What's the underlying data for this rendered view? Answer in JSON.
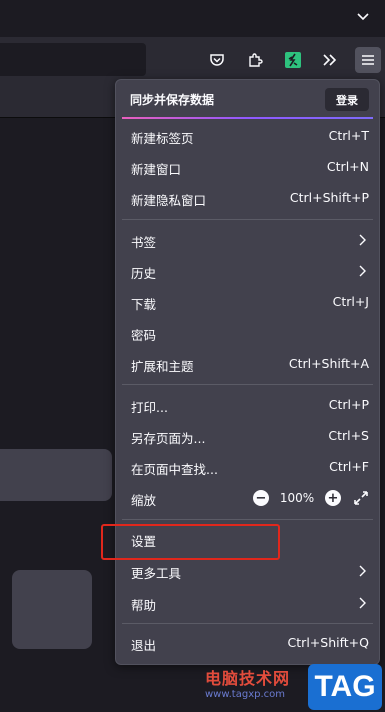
{
  "toolbar": {
    "icons": [
      "pocket-icon",
      "extensions-icon",
      "green-extension-icon",
      "overflow-icon",
      "menu-icon"
    ]
  },
  "panel": {
    "sync_label": "同步并保存数据",
    "login_label": "登录",
    "items": {
      "new_tab": {
        "label": "新建标签页",
        "shortcut": "Ctrl+T"
      },
      "new_window": {
        "label": "新建窗口",
        "shortcut": "Ctrl+N"
      },
      "new_private": {
        "label": "新建隐私窗口",
        "shortcut": "Ctrl+Shift+P"
      },
      "bookmarks": {
        "label": "书签"
      },
      "history": {
        "label": "历史"
      },
      "downloads": {
        "label": "下载",
        "shortcut": "Ctrl+J"
      },
      "passwords": {
        "label": "密码"
      },
      "addons": {
        "label": "扩展和主题",
        "shortcut": "Ctrl+Shift+A"
      },
      "print": {
        "label": "打印...",
        "shortcut": "Ctrl+P"
      },
      "save_as": {
        "label": "另存页面为...",
        "shortcut": "Ctrl+S"
      },
      "find": {
        "label": "在页面中查找...",
        "shortcut": "Ctrl+F"
      },
      "zoom": {
        "label": "缩放",
        "value": "100%",
        "minus": "−",
        "plus": "+"
      },
      "settings": {
        "label": "设置"
      },
      "more_tools": {
        "label": "更多工具"
      },
      "help": {
        "label": "帮助"
      },
      "quit": {
        "label": "退出",
        "shortcut": "Ctrl+Shift+Q"
      }
    }
  },
  "watermark": {
    "site_name": "电脑技术网",
    "url": "www.tagxp.com",
    "badge": "TAG"
  },
  "colors": {
    "highlight": "#e0271c",
    "panel_bg": "#42414d",
    "accent_gradient": [
      "#e95fbd",
      "#9059ff"
    ]
  }
}
